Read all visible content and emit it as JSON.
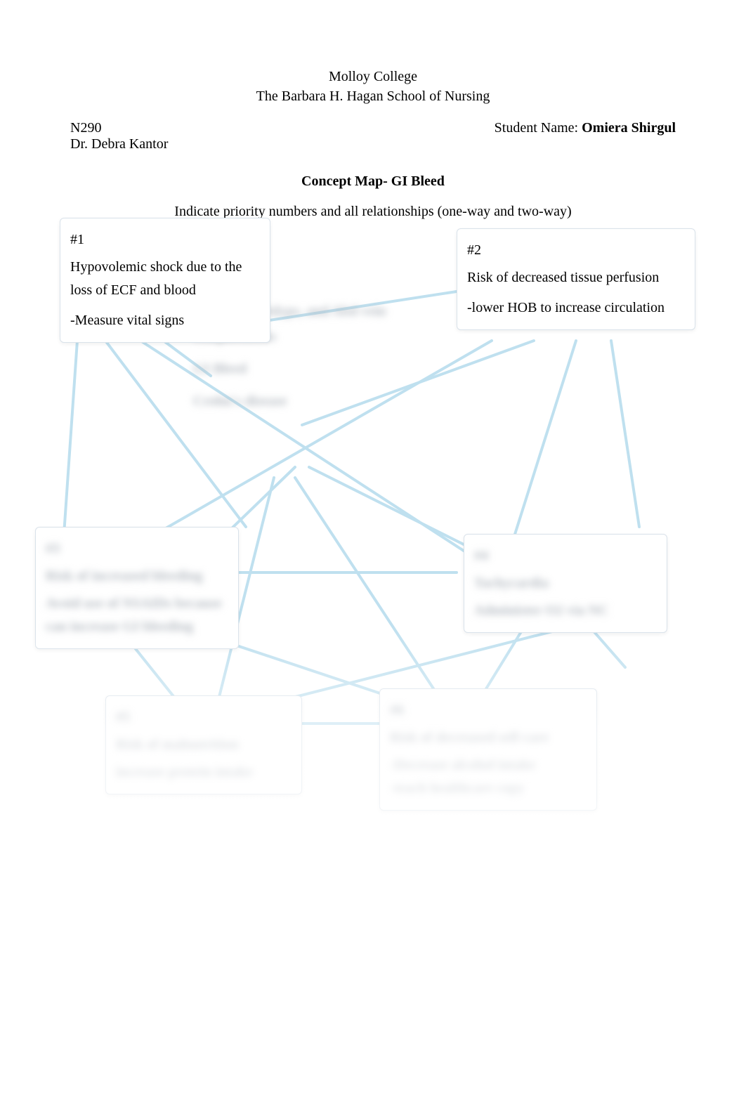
{
  "header": {
    "line1": "Molloy College",
    "line2": "The Barbara H. Hagan School of Nursing"
  },
  "info": {
    "course": "N290",
    "instructor": "Dr. Debra Kantor",
    "student_label": "Student Name: ",
    "student_name": "Omiera Shirgul"
  },
  "title": "Concept Map- GI Bleed",
  "subtitle": "Indicate priority numbers and all relationships (one-way and two-way)",
  "center": {
    "line1": "Infections, Polyps, and Abd vein",
    "line2": "complications",
    "line3": "GI Bleed",
    "line4": "Crohn's disease"
  },
  "boxes": {
    "b1": {
      "num": "#1",
      "l1": "Hypovolemic shock due to the",
      "l2": "loss of ECF  and blood",
      "l3": "-Measure vital signs"
    },
    "b2": {
      "num": "#2",
      "l1": "Risk of decreased tissue perfusion",
      "l2": "-lower HOB to increase circulation"
    },
    "b3": {
      "num": "#3",
      "l1": "Risk of increased bleeding",
      "l2": "Avoid use of NSAIDs because",
      "l3": "can increase GI bleeding"
    },
    "b4": {
      "num": "#4",
      "l1": "Tachycardia",
      "l2": "Administer O2 via NC"
    },
    "b5": {
      "num": "#5",
      "l1": "Risk of malnutrition",
      "l2": "increase protein intake"
    },
    "b6": {
      "num": "#6",
      "l1": "Risk of decreased self-care",
      "l2": "-Decrease alcohol intake",
      "l3": "-teach healthcare copy"
    }
  }
}
